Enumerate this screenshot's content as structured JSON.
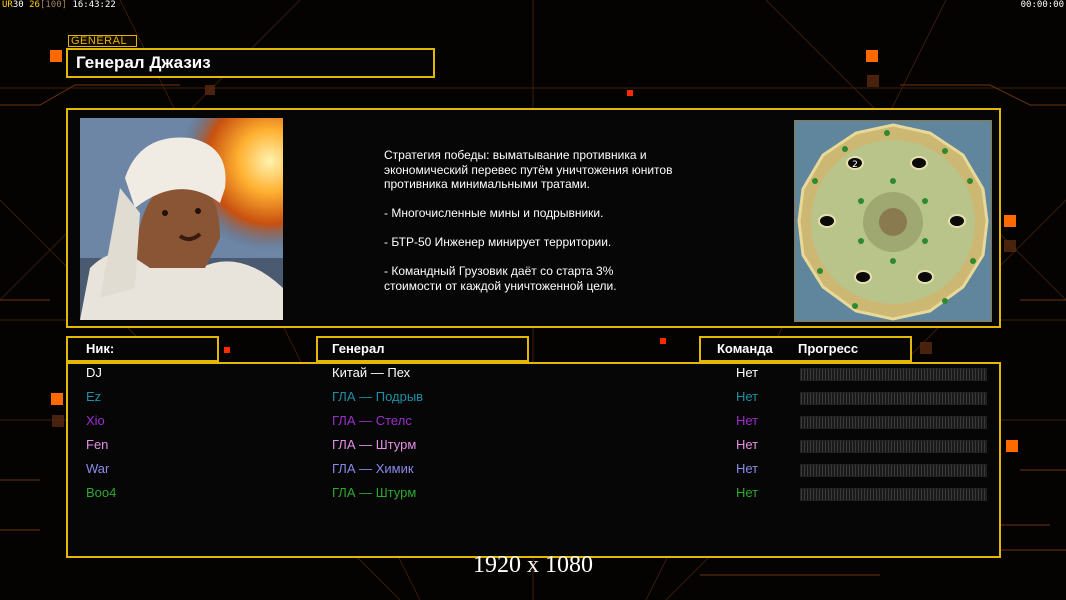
{
  "hud": {
    "fps_label": "UR",
    "fps": "30",
    "count": "26",
    "max": "[100]",
    "clock": "16:43:22",
    "timer": "00:00:00"
  },
  "general": {
    "tag": "GENERAL",
    "name": "Генерал Джазиз",
    "description": [
      "Стратегия победы: выматывание противника и\n экономический перевес путём уничтожения юнитов\n противника минимальными тратами.",
      "- Многочисленные мины и подрывники.",
      "- БТР-50 Инженер минирует территории.",
      "- Командный Грузовик даёт со старта 3%\n стоимости от каждой уничтоженной цели."
    ],
    "minimap_marker": "2"
  },
  "headers": {
    "nick": "Ник:",
    "general": "Генерал",
    "team": "Команда",
    "progress": "Прогресс"
  },
  "players": [
    {
      "nick": "DJ",
      "general": "Китай — Пех",
      "team": "Нет",
      "progress": 0,
      "color": "#ffffff"
    },
    {
      "nick": "Ez",
      "general": "ГЛА — Подрыв",
      "team": "Нет",
      "progress": 0,
      "color": "#1e8fa6"
    },
    {
      "nick": "Xio",
      "general": "ГЛА — Стелс",
      "team": "Нет",
      "progress": 0,
      "color": "#9b2fc9"
    },
    {
      "nick": "Fen",
      "general": "ГЛА — Штурм",
      "team": "Нет",
      "progress": 0,
      "color": "#e58fe5"
    },
    {
      "nick": "War",
      "general": "ГЛА — Химик",
      "team": "Нет",
      "progress": 0,
      "color": "#8a8ae8"
    },
    {
      "nick": "Boo4",
      "general": "ГЛА — Штурм",
      "team": "Нет",
      "progress": 0,
      "color": "#2fa82f"
    }
  ],
  "resolution": "1920 x 1080",
  "colors": {
    "accent": "#e3b800",
    "orange": "#ff6a00"
  }
}
